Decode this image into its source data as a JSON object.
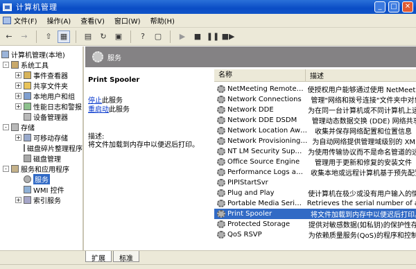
{
  "window": {
    "title": "计算机管理"
  },
  "menu": [
    "文件(F)",
    "操作(A)",
    "查看(V)",
    "窗口(W)",
    "帮助(H)"
  ],
  "tree": {
    "items": [
      {
        "label": "计算机管理(本地)",
        "level": 0,
        "toggle": "",
        "icon": "computer-icon"
      },
      {
        "label": "系统工具",
        "level": 1,
        "toggle": "-",
        "icon": "tools-icon"
      },
      {
        "label": "事件查看器",
        "level": 2,
        "toggle": "+",
        "icon": "event-viewer-icon"
      },
      {
        "label": "共享文件夹",
        "level": 2,
        "toggle": "+",
        "icon": "shared-folder-icon"
      },
      {
        "label": "本地用户和组",
        "level": 2,
        "toggle": "+",
        "icon": "users-icon"
      },
      {
        "label": "性能日志和警报",
        "level": 2,
        "toggle": "+",
        "icon": "performance-icon"
      },
      {
        "label": "设备管理器",
        "level": 2,
        "toggle": "",
        "icon": "device-manager-icon"
      },
      {
        "label": "存储",
        "level": 1,
        "toggle": "-",
        "icon": "storage-icon"
      },
      {
        "label": "可移动存储",
        "level": 2,
        "toggle": "+",
        "icon": "removable-storage-icon"
      },
      {
        "label": "磁盘碎片整理程序",
        "level": 2,
        "toggle": "",
        "icon": "defrag-icon"
      },
      {
        "label": "磁盘管理",
        "level": 2,
        "toggle": "",
        "icon": "disk-management-icon"
      },
      {
        "label": "服务和应用程序",
        "level": 1,
        "toggle": "-",
        "icon": "services-apps-icon"
      },
      {
        "label": "服务",
        "level": 2,
        "toggle": "",
        "icon": "gear-icon",
        "selected": true
      },
      {
        "label": "WMI 控件",
        "level": 2,
        "toggle": "",
        "icon": "wmi-icon"
      },
      {
        "label": "索引服务",
        "level": 2,
        "toggle": "+",
        "icon": "index-icon"
      }
    ]
  },
  "header": {
    "title": "服务"
  },
  "description": {
    "service_name": "Print Spooler",
    "stop_link": "停止",
    "stop_suffix": "此服务",
    "restart_link": "重启动",
    "restart_suffix": "此服务",
    "label": "描述:",
    "text": "将文件加载到内存中以便迟后打印。"
  },
  "list": {
    "col_name": "名称",
    "col_desc": "描述",
    "rows": [
      {
        "name": "NetMeeting Remote De...",
        "desc": "使授权用户能够通过使用 NetMeeting"
      },
      {
        "name": "Network Connections",
        "desc": "管理\"网络和拨号连接\"文件夹中对象"
      },
      {
        "name": "Network DDE",
        "desc": "为在同一台计算机或不同计算机上运行"
      },
      {
        "name": "Network DDE DSDM",
        "desc": "管理动态数据交换 (DDE) 网络共享"
      },
      {
        "name": "Network Location Awar...",
        "desc": "收集并保存网络配置和位置信息"
      },
      {
        "name": "Network Provisioning S...",
        "desc": "为自动网络提供管理域级别的 XML"
      },
      {
        "name": "NT LM Security Support...",
        "desc": "为使用传输协议而不是命名管道的远程"
      },
      {
        "name": "Office Source Engine",
        "desc": "管理用于更新和修复的安装文件"
      },
      {
        "name": "Performance Logs and ...",
        "desc": "收集本地或远程计算机基于预先配置"
      },
      {
        "name": "PIPIStartSvr",
        "desc": ""
      },
      {
        "name": "Plug and Play",
        "desc": "使计算机在极少或没有用户输入的情况"
      },
      {
        "name": "Portable Media Serial N...",
        "desc": "Retrieves the serial number of any"
      },
      {
        "name": "Print Spooler",
        "desc": "将文件加载到内存中以便迟后打印。",
        "highlight": true
      },
      {
        "name": "Protected Storage",
        "desc": "提供对敏感数据(如私钥)的保护性存储"
      },
      {
        "name": "QoS RSVP",
        "desc": "为依赖质量服务(QoS)的程序和控制应"
      }
    ]
  },
  "tabs": [
    "扩展",
    "标准"
  ]
}
